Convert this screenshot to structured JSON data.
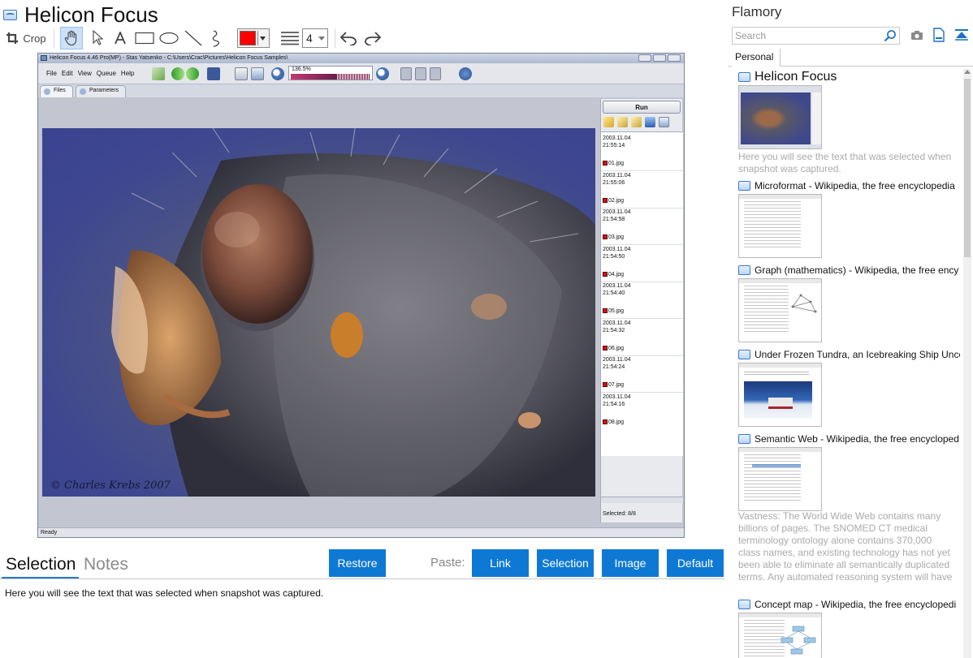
{
  "window": {
    "title": "Helicon Focus"
  },
  "toolbar": {
    "crop_label": "Crop",
    "line_size": "4",
    "accent": "#ff0000"
  },
  "snapshot": {
    "title": "Helicon Focus 4.46 Pro(MP) - Stas Yatsenko - C:\\Users\\Crac\\Pictures\\Helicon Focus Samples\\",
    "menu": [
      "File",
      "Edit",
      "View",
      "Queue",
      "Help"
    ],
    "zoom": "136.5%",
    "tabs": [
      "Files",
      "Parameters"
    ],
    "run_label": "Run",
    "copyright": "© Charles Krebs 2007",
    "files": [
      {
        "date": "2003.11.04",
        "time": "21:55:14",
        "name": "01.jpg"
      },
      {
        "date": "2003.11.04",
        "time": "21:55:06",
        "name": "02.jpg"
      },
      {
        "date": "2003.11.04",
        "time": "21:54:58",
        "name": "03.jpg"
      },
      {
        "date": "2003.11.04",
        "time": "21:54:50",
        "name": "04.jpg"
      },
      {
        "date": "2003.11.04",
        "time": "21:54:40",
        "name": "05.jpg"
      },
      {
        "date": "2003.11.04",
        "time": "21:54:32",
        "name": "06.jpg"
      },
      {
        "date": "2003.11.04",
        "time": "21:54:24",
        "name": "07.jpg"
      },
      {
        "date": "2003.11.04",
        "time": "21:54:16",
        "name": "08.jpg"
      }
    ],
    "selected": "Selected: 8/8",
    "status": "Ready"
  },
  "bottom": {
    "tabs": [
      "Selection",
      "Notes"
    ],
    "restore_label": "Restore",
    "paste_label": "Paste:",
    "paste_buttons": [
      "Link",
      "Selection",
      "Image",
      "Default"
    ],
    "selection_text": "Here you will see the text that was selected when snapshot was captured."
  },
  "sidebar": {
    "title": "Flamory",
    "search_placeholder": "Search",
    "tab": "Personal",
    "entries": [
      {
        "title": "Helicon Focus",
        "desc": "Here you will see the text that was selected when snapshot was captured."
      },
      {
        "title": "Microformat - Wikipedia, the free encyclopedia"
      },
      {
        "title": "Graph (mathematics) - Wikipedia, the free ency"
      },
      {
        "title": "Under Frozen Tundra, an Icebreaking Ship Unco"
      },
      {
        "title": "Semantic Web - Wikipedia, the free encycloped",
        "desc": "Vastness: The World Wide Web contains many billions of pages. The SNOMED CT medical terminology ontology alone contains 370,000 class names, and existing technology has not yet been able to eliminate all semantically duplicated terms. Any automated reasoning system will have to deal with truly huge inputs."
      },
      {
        "title": "Concept map - Wikipedia, the free encyclopedi"
      }
    ]
  }
}
